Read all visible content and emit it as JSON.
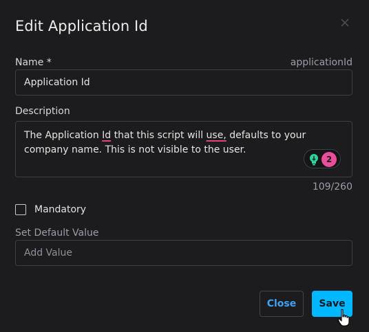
{
  "dialog": {
    "title": "Edit Application Id"
  },
  "name_field": {
    "label": "Name *",
    "key_hint": "applicationId",
    "value": "Application Id"
  },
  "description_field": {
    "label": "Description",
    "text_1": "The Application ",
    "err_1": "Id",
    "text_2": " that this script will ",
    "err_2": "use,",
    "text_3": " defaults to your company name. This is not visible to the user.",
    "char_count": "109/260",
    "grammar_issue_count": "2"
  },
  "mandatory": {
    "label": "Mandatory",
    "checked": false
  },
  "default_value": {
    "label": "Set Default Value",
    "placeholder": "Add Value"
  },
  "buttons": {
    "close_label": "Close",
    "save_label": "Save"
  },
  "colors": {
    "accent": "#00b8ff",
    "link": "#3da2f7",
    "grammar_badge": "#e94e9a",
    "bulb": "#2fd39a"
  }
}
